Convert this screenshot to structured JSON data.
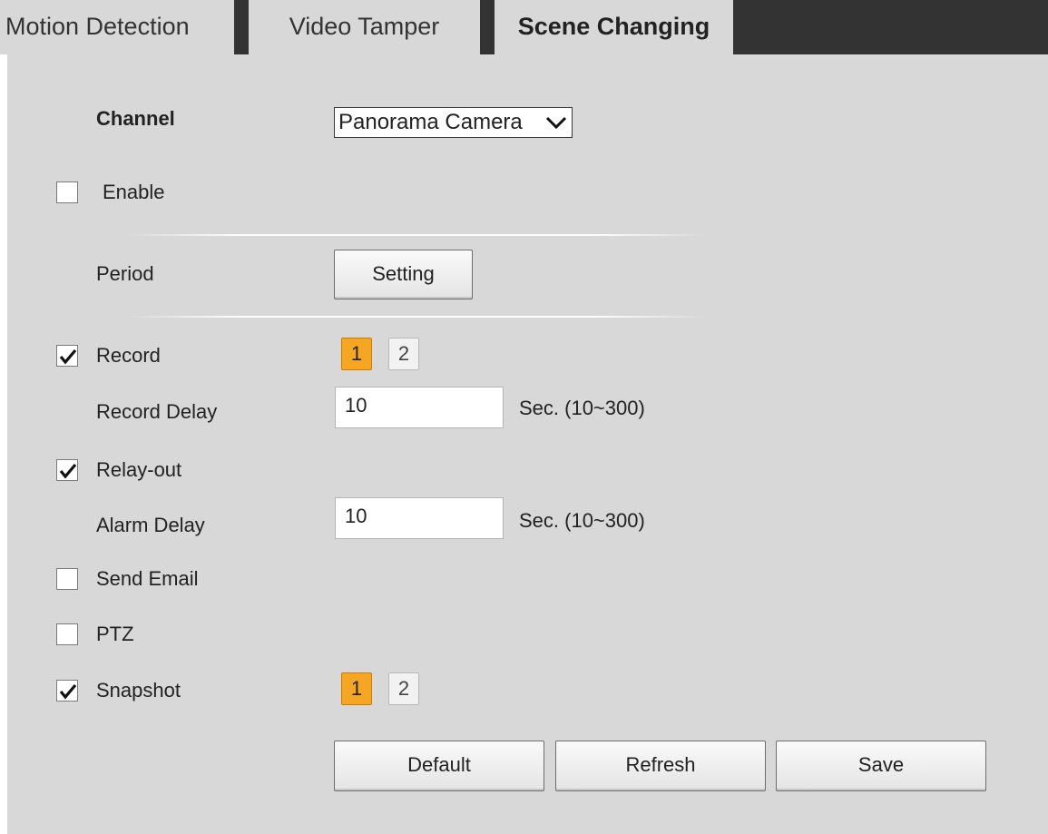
{
  "tabs": [
    {
      "label": "Motion Detection"
    },
    {
      "label": "Video Tamper"
    },
    {
      "label": "Scene Changing"
    }
  ],
  "form": {
    "channel_label": "Channel",
    "channel_value": "Panorama Camera",
    "enable_label": "Enable",
    "enable_checked": false,
    "period_label": "Period",
    "setting_button": "Setting",
    "record_label": "Record",
    "record_checked": true,
    "record_channels": [
      {
        "label": "1",
        "selected": true
      },
      {
        "label": "2",
        "selected": false
      }
    ],
    "record_delay_label": "Record Delay",
    "record_delay_value": "10",
    "record_delay_unit": "Sec. (10~300)",
    "relay_label": "Relay-out",
    "relay_checked": true,
    "alarm_delay_label": "Alarm Delay",
    "alarm_delay_value": "10",
    "alarm_delay_unit": "Sec. (10~300)",
    "send_email_label": "Send Email",
    "send_email_checked": false,
    "ptz_label": "PTZ",
    "ptz_checked": false,
    "snapshot_label": "Snapshot",
    "snapshot_checked": true,
    "snapshot_channels": [
      {
        "label": "1",
        "selected": true
      },
      {
        "label": "2",
        "selected": false
      }
    ]
  },
  "buttons": {
    "default": "Default",
    "refresh": "Refresh",
    "save": "Save"
  },
  "colors": {
    "panel_bg": "#d8d8d8",
    "tab_dark": "#333333",
    "selected_channel": "#f5a623"
  }
}
